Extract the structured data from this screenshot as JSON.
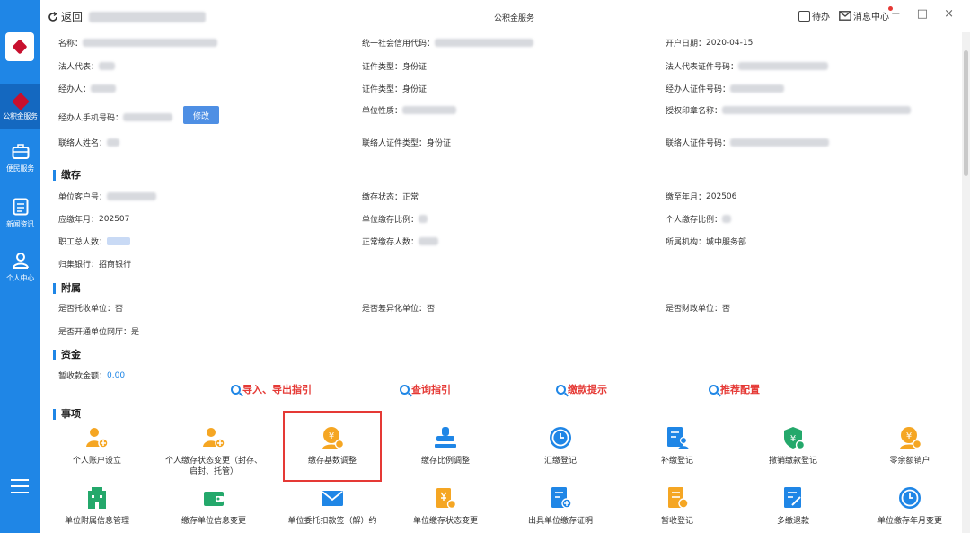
{
  "topbar": {
    "back_label": "返回",
    "title": "公积金服务",
    "todo_label": "待办",
    "message_label": "消息中心",
    "minimize": "−",
    "maximize": "□",
    "close": "×"
  },
  "sidebar": {
    "items": [
      {
        "label": "公积金服务"
      },
      {
        "label": "便民服务"
      },
      {
        "label": "新闻资讯"
      },
      {
        "label": "个人中心"
      }
    ]
  },
  "info": {
    "name_k": "名称：",
    "credit_code_k": "统一社会信用代码：",
    "open_date_k": "开户日期：",
    "open_date_v": "2020-04-15",
    "legal_rep_k": "法人代表：",
    "cert_type_k": "证件类型：",
    "cert_type_v": "身份证",
    "legal_cert_no_k": "法人代表证件号码：",
    "handler_k": "经办人：",
    "cert_type2_k": "证件类型：",
    "cert_type2_v": "身份证",
    "handler_cert_no_k": "经办人证件号码：",
    "handler_phone_k": "经办人手机号码：",
    "edit_label": "修改",
    "unit_nature_k": "单位性质：",
    "auth_seal_k": "授权印章名称：",
    "contact_name_k": "联络人姓名：",
    "contact_cert_type_k": "联络人证件类型：",
    "contact_cert_type_v": "身份证",
    "contact_cert_no_k": "联络人证件号码："
  },
  "deposit": {
    "title": "缴存",
    "unit_customer_no_k": "单位客户号：",
    "status_k": "缴存状态：",
    "status_v": "正常",
    "paid_until_k": "缴至年月：",
    "paid_until_v": "202506",
    "due_month_k": "应缴年月：",
    "due_month_v": "202507",
    "unit_ratio_k": "单位缴存比例：",
    "person_ratio_k": "个人缴存比例：",
    "total_staff_k": "职工总人数：",
    "normal_count_k": "正常缴存人数：",
    "institution_k": "所属机构：",
    "institution_v": "城中服务部",
    "bank_k": "归集银行：",
    "bank_v": "招商银行"
  },
  "attach": {
    "title": "附属",
    "entrusted_k": "是否托收单位：",
    "entrusted_v": "否",
    "diff_k": "是否差异化单位：",
    "diff_v": "否",
    "finance_k": "是否财政单位：",
    "finance_v": "否",
    "online_hall_k": "是否开通单位网厅：",
    "online_hall_v": "是"
  },
  "funds": {
    "title": "资金",
    "temp_k": "暂收款金额：",
    "temp_v": "0.00"
  },
  "guides": [
    {
      "label": "导入、导出指引"
    },
    {
      "label": "查询指引"
    },
    {
      "label": "缴款提示"
    },
    {
      "label": "推荐配置"
    }
  ],
  "matters": {
    "title": "事项",
    "row1": [
      {
        "label": "个人账户设立",
        "icon": "person-add-icon"
      },
      {
        "label": "个人缴存状态变更（封存、启封、托管）",
        "icon": "person-add-icon"
      },
      {
        "label": "缴存基数调整",
        "icon": "base-adjust-icon"
      },
      {
        "label": "缴存比例调整",
        "icon": "stamp-icon"
      },
      {
        "label": "汇缴登记",
        "icon": "clock-icon"
      },
      {
        "label": "补缴登记",
        "icon": "document-person-icon"
      },
      {
        "label": "撤销缴款登记",
        "icon": "shield-icon"
      },
      {
        "label": "零余额销户",
        "icon": "money-person-icon"
      }
    ],
    "row2": [
      {
        "label": "单位附属信息管理",
        "icon": "building-icon"
      },
      {
        "label": "缴存单位信息变更",
        "icon": "wallet-icon"
      },
      {
        "label": "单位委托扣款签（解）约",
        "icon": "mail-icon"
      },
      {
        "label": "单位缴存状态变更",
        "icon": "card-icon"
      },
      {
        "label": "出具单位缴存证明",
        "icon": "doc-add-icon"
      },
      {
        "label": "暂收登记",
        "icon": "doc-money-icon"
      },
      {
        "label": "多缴退款",
        "icon": "doc-edit-icon"
      },
      {
        "label": "单位缴存年月变更",
        "icon": "clock-icon"
      }
    ]
  },
  "colors": {
    "sidebar": "#1f86e6",
    "accent_red": "#e53935",
    "icon_orange": "#f5a623",
    "icon_green": "#24a86b"
  }
}
